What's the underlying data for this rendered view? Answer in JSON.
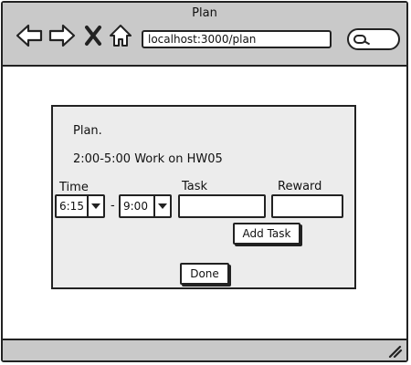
{
  "window": {
    "title": "Plan",
    "url": "localhost:3000/plan"
  },
  "toolbar": {
    "icons": [
      "back-arrow-icon",
      "forward-arrow-icon",
      "close-x-icon",
      "home-icon",
      "search-icon"
    ]
  },
  "plan": {
    "heading": "Plan.",
    "entry": "2:00-5:00  Work on HW05",
    "time_label": "Time",
    "task_label": "Task",
    "reward_label": "Reward",
    "start_time": "6:15",
    "separator": "-",
    "end_time": "9:00",
    "add_task_label": "Add Task",
    "done_label": "Done"
  }
}
